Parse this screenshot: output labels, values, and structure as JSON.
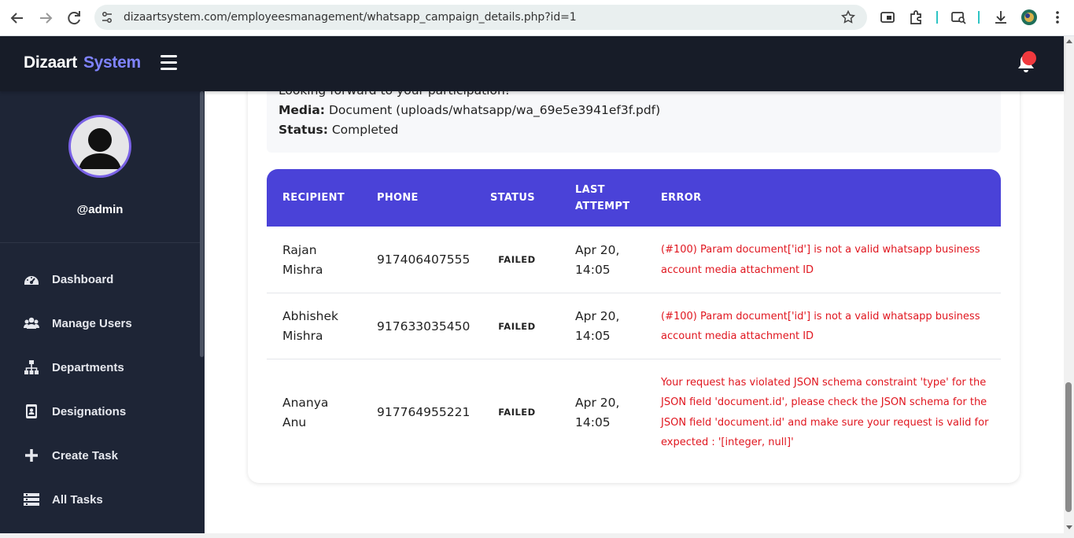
{
  "browser": {
    "url": "dizaartsystem.com/employeesmanagement/whatsapp_campaign_details.php?id=1"
  },
  "header": {
    "brand_primary": "Dizaart",
    "brand_accent": "System"
  },
  "sidebar": {
    "username": "@admin",
    "items": [
      {
        "label": "Dashboard",
        "icon": "dashboard-icon"
      },
      {
        "label": "Manage Users",
        "icon": "users-icon"
      },
      {
        "label": "Departments",
        "icon": "sitemap-icon"
      },
      {
        "label": "Designations",
        "icon": "id-badge-icon"
      },
      {
        "label": "Create Task",
        "icon": "plus-icon"
      },
      {
        "label": "All Tasks",
        "icon": "list-icon"
      }
    ]
  },
  "campaign": {
    "message_tail": "Looking forward to your participation!",
    "media_label": "Media:",
    "media_value": "Document (uploads/whatsapp/wa_69e5e3941ef3f.pdf)",
    "status_label": "Status:",
    "status_value": "Completed"
  },
  "table": {
    "headers": {
      "recipient": "RECIPIENT",
      "phone": "PHONE",
      "status": "STATUS",
      "last_attempt_1": "LAST",
      "last_attempt_2": "ATTEMPT",
      "error": "ERROR"
    },
    "rows": [
      {
        "name_1": "Rajan",
        "name_2": "Mishra",
        "phone": "917406407555",
        "status": "FAILED",
        "date_1": "Apr 20,",
        "date_2": "14:05",
        "error": "(#100) Param document['id'] is not a valid whatsapp business account media attachment ID"
      },
      {
        "name_1": "Abhishek",
        "name_2": "Mishra",
        "phone": "917633035450",
        "status": "FAILED",
        "date_1": "Apr 20,",
        "date_2": "14:05",
        "error": "(#100) Param document['id'] is not a valid whatsapp business account media attachment ID"
      },
      {
        "name_1": "Ananya",
        "name_2": "Anu",
        "phone": "917764955221",
        "status": "FAILED",
        "date_1": "Apr 20,",
        "date_2": "14:05",
        "error": "Your request has violated JSON schema constraint 'type' for the JSON field 'document.id', please check the JSON schema for the JSON field 'document.id' and make sure your request is valid for expected : '[integer, null]'"
      }
    ]
  },
  "colors": {
    "header_bg": "#171c28",
    "sidebar_bg": "#1e2536",
    "accent": "#7f83ff",
    "table_header": "#4a42d8",
    "error": "#e0161f",
    "notification_dot": "#f0393e"
  }
}
